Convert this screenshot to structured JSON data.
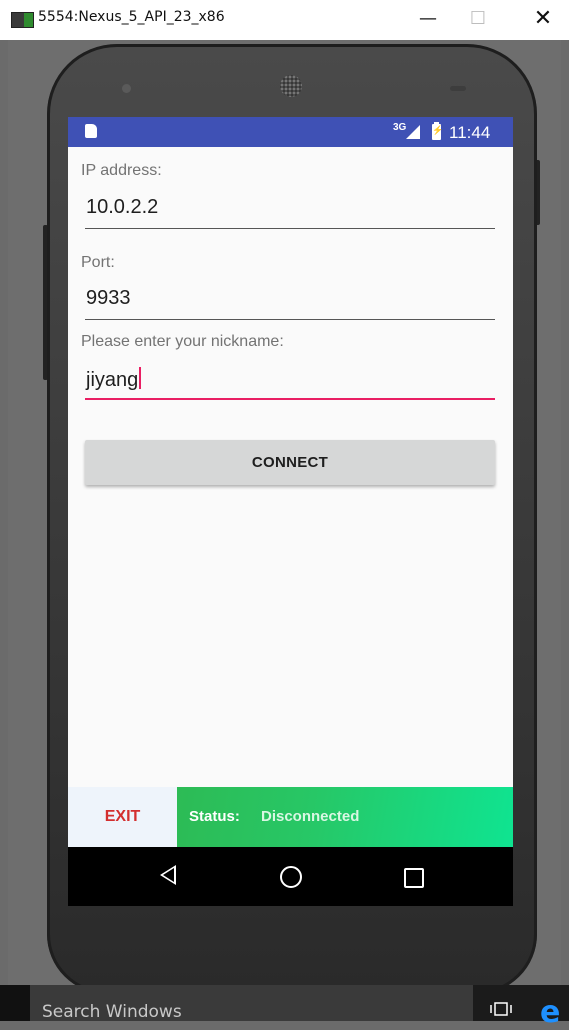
{
  "window": {
    "title": "5554:Nexus_5_API_23_x86",
    "minimize": "—",
    "maximize": "☐",
    "close": "✕"
  },
  "statusbar": {
    "network": "3G",
    "time": "11:44"
  },
  "form": {
    "ip_label": "IP address:",
    "ip_value": "10.0.2.2",
    "port_label": "Port:",
    "port_value": "9933",
    "nickname_label": "Please enter your nickname:",
    "nickname_value": "jiyang"
  },
  "buttons": {
    "connect": "CONNECT",
    "exit": "EXIT"
  },
  "status": {
    "label": "Status:",
    "value": "Disconnected",
    "colors": {
      "start": "#2dbb55",
      "end": "#0fe491"
    }
  },
  "navbar": {
    "icons": [
      "back-icon",
      "home-icon",
      "recent-apps-icon"
    ]
  },
  "taskbar": {
    "search_placeholder": "Search Windows",
    "icons": [
      "task-view-icon",
      "edge-icon"
    ]
  },
  "colors": {
    "statusbar": "#3f51b5",
    "accent": "#e91e63",
    "exit_text": "#d32f2f"
  }
}
